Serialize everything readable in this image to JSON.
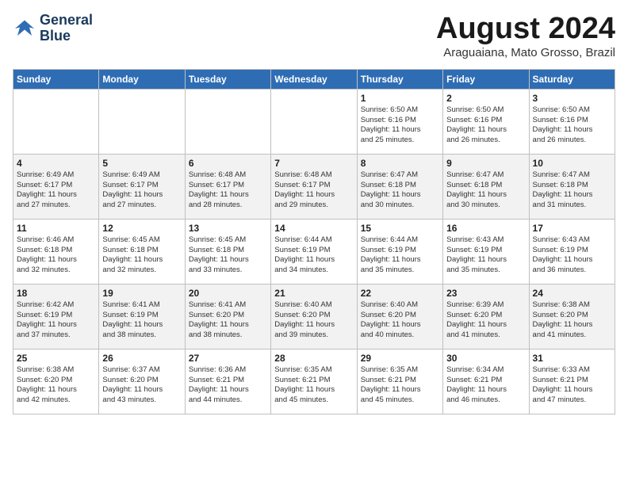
{
  "logo": {
    "line1": "General",
    "line2": "Blue"
  },
  "title": "August 2024",
  "location": "Araguaiana, Mato Grosso, Brazil",
  "days_header": [
    "Sunday",
    "Monday",
    "Tuesday",
    "Wednesday",
    "Thursday",
    "Friday",
    "Saturday"
  ],
  "weeks": [
    [
      {
        "num": "",
        "text": ""
      },
      {
        "num": "",
        "text": ""
      },
      {
        "num": "",
        "text": ""
      },
      {
        "num": "",
        "text": ""
      },
      {
        "num": "1",
        "text": "Sunrise: 6:50 AM\nSunset: 6:16 PM\nDaylight: 11 hours\nand 25 minutes."
      },
      {
        "num": "2",
        "text": "Sunrise: 6:50 AM\nSunset: 6:16 PM\nDaylight: 11 hours\nand 26 minutes."
      },
      {
        "num": "3",
        "text": "Sunrise: 6:50 AM\nSunset: 6:16 PM\nDaylight: 11 hours\nand 26 minutes."
      }
    ],
    [
      {
        "num": "4",
        "text": "Sunrise: 6:49 AM\nSunset: 6:17 PM\nDaylight: 11 hours\nand 27 minutes."
      },
      {
        "num": "5",
        "text": "Sunrise: 6:49 AM\nSunset: 6:17 PM\nDaylight: 11 hours\nand 27 minutes."
      },
      {
        "num": "6",
        "text": "Sunrise: 6:48 AM\nSunset: 6:17 PM\nDaylight: 11 hours\nand 28 minutes."
      },
      {
        "num": "7",
        "text": "Sunrise: 6:48 AM\nSunset: 6:17 PM\nDaylight: 11 hours\nand 29 minutes."
      },
      {
        "num": "8",
        "text": "Sunrise: 6:47 AM\nSunset: 6:18 PM\nDaylight: 11 hours\nand 30 minutes."
      },
      {
        "num": "9",
        "text": "Sunrise: 6:47 AM\nSunset: 6:18 PM\nDaylight: 11 hours\nand 30 minutes."
      },
      {
        "num": "10",
        "text": "Sunrise: 6:47 AM\nSunset: 6:18 PM\nDaylight: 11 hours\nand 31 minutes."
      }
    ],
    [
      {
        "num": "11",
        "text": "Sunrise: 6:46 AM\nSunset: 6:18 PM\nDaylight: 11 hours\nand 32 minutes."
      },
      {
        "num": "12",
        "text": "Sunrise: 6:45 AM\nSunset: 6:18 PM\nDaylight: 11 hours\nand 32 minutes."
      },
      {
        "num": "13",
        "text": "Sunrise: 6:45 AM\nSunset: 6:18 PM\nDaylight: 11 hours\nand 33 minutes."
      },
      {
        "num": "14",
        "text": "Sunrise: 6:44 AM\nSunset: 6:19 PM\nDaylight: 11 hours\nand 34 minutes."
      },
      {
        "num": "15",
        "text": "Sunrise: 6:44 AM\nSunset: 6:19 PM\nDaylight: 11 hours\nand 35 minutes."
      },
      {
        "num": "16",
        "text": "Sunrise: 6:43 AM\nSunset: 6:19 PM\nDaylight: 11 hours\nand 35 minutes."
      },
      {
        "num": "17",
        "text": "Sunrise: 6:43 AM\nSunset: 6:19 PM\nDaylight: 11 hours\nand 36 minutes."
      }
    ],
    [
      {
        "num": "18",
        "text": "Sunrise: 6:42 AM\nSunset: 6:19 PM\nDaylight: 11 hours\nand 37 minutes."
      },
      {
        "num": "19",
        "text": "Sunrise: 6:41 AM\nSunset: 6:19 PM\nDaylight: 11 hours\nand 38 minutes."
      },
      {
        "num": "20",
        "text": "Sunrise: 6:41 AM\nSunset: 6:20 PM\nDaylight: 11 hours\nand 38 minutes."
      },
      {
        "num": "21",
        "text": "Sunrise: 6:40 AM\nSunset: 6:20 PM\nDaylight: 11 hours\nand 39 minutes."
      },
      {
        "num": "22",
        "text": "Sunrise: 6:40 AM\nSunset: 6:20 PM\nDaylight: 11 hours\nand 40 minutes."
      },
      {
        "num": "23",
        "text": "Sunrise: 6:39 AM\nSunset: 6:20 PM\nDaylight: 11 hours\nand 41 minutes."
      },
      {
        "num": "24",
        "text": "Sunrise: 6:38 AM\nSunset: 6:20 PM\nDaylight: 11 hours\nand 41 minutes."
      }
    ],
    [
      {
        "num": "25",
        "text": "Sunrise: 6:38 AM\nSunset: 6:20 PM\nDaylight: 11 hours\nand 42 minutes."
      },
      {
        "num": "26",
        "text": "Sunrise: 6:37 AM\nSunset: 6:20 PM\nDaylight: 11 hours\nand 43 minutes."
      },
      {
        "num": "27",
        "text": "Sunrise: 6:36 AM\nSunset: 6:21 PM\nDaylight: 11 hours\nand 44 minutes."
      },
      {
        "num": "28",
        "text": "Sunrise: 6:35 AM\nSunset: 6:21 PM\nDaylight: 11 hours\nand 45 minutes."
      },
      {
        "num": "29",
        "text": "Sunrise: 6:35 AM\nSunset: 6:21 PM\nDaylight: 11 hours\nand 45 minutes."
      },
      {
        "num": "30",
        "text": "Sunrise: 6:34 AM\nSunset: 6:21 PM\nDaylight: 11 hours\nand 46 minutes."
      },
      {
        "num": "31",
        "text": "Sunrise: 6:33 AM\nSunset: 6:21 PM\nDaylight: 11 hours\nand 47 minutes."
      }
    ]
  ]
}
